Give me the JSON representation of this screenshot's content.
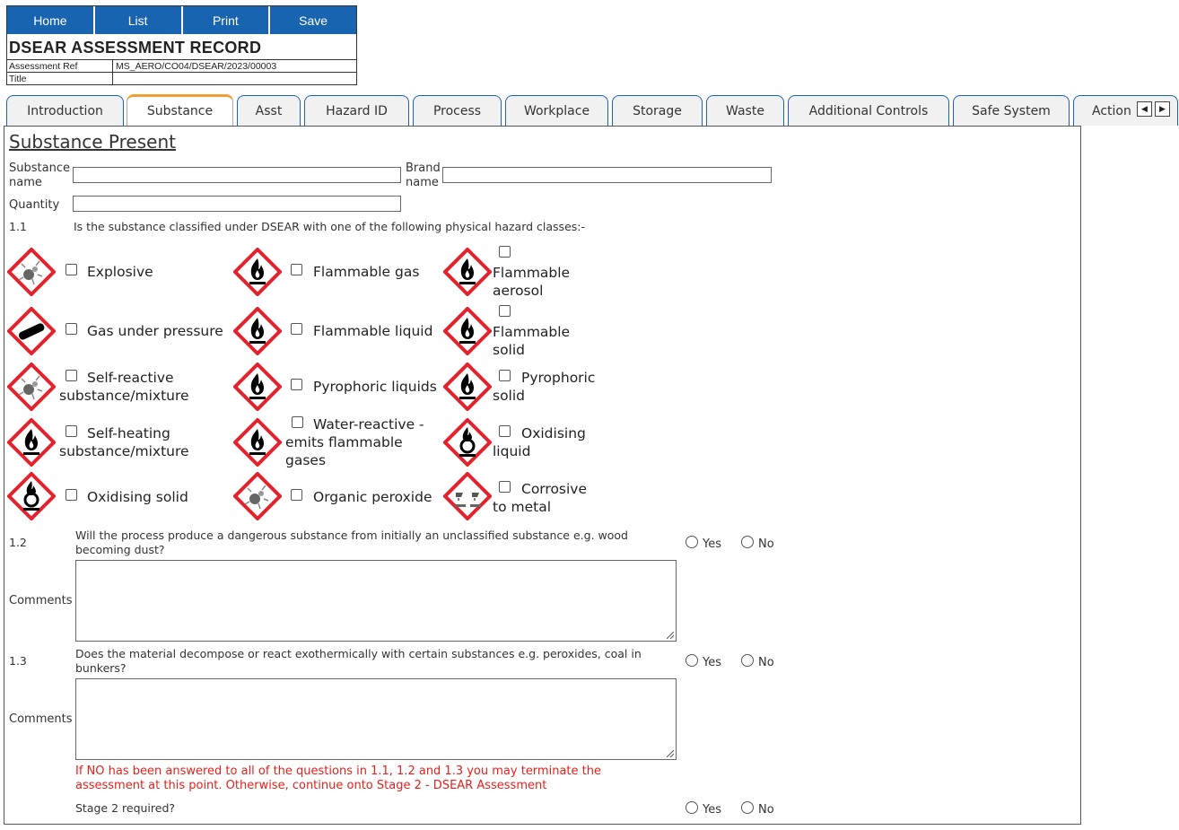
{
  "nav": {
    "home": "Home",
    "list": "List",
    "print": "Print",
    "save": "Save"
  },
  "record": {
    "title": "DSEAR ASSESSMENT RECORD",
    "ref_label": "Assessment Ref",
    "ref_value": "MS_AERO/CO04/DSEAR/2023/00003",
    "title_label": "Title",
    "title_value": ""
  },
  "tabs": [
    {
      "label": "Introduction"
    },
    {
      "label": "Substance"
    },
    {
      "label": "Asst"
    },
    {
      "label": "Hazard ID"
    },
    {
      "label": "Process"
    },
    {
      "label": "Workplace"
    },
    {
      "label": "Storage"
    },
    {
      "label": "Waste"
    },
    {
      "label": "Additional Controls"
    },
    {
      "label": "Safe System"
    },
    {
      "label": "Action"
    }
  ],
  "active_tab": "Substance",
  "section": {
    "heading": "Substance Present",
    "substance_label_1": "Substance",
    "substance_label_2": "name",
    "substance_value": "",
    "brand_label_1": "Brand",
    "brand_label_2": "name",
    "brand_value": "",
    "quantity_label": "Quantity",
    "quantity_value": ""
  },
  "q1_1": {
    "num": "1.1",
    "text": "Is the substance classified under DSEAR with one of the following physical hazard classes:-"
  },
  "hazards": {
    "explosive": "Explosive",
    "flam_gas": "Flammable gas",
    "flam_aerosol_1": "Flammable",
    "flam_aerosol_2": "aerosol",
    "gas_pressure": "Gas under pressure",
    "flam_liquid": "Flammable liquid",
    "flam_solid_1": "Flammable",
    "flam_solid_2": "solid",
    "self_reactive_1": "Self-reactive",
    "self_reactive_2": "substance/mixture",
    "pyro_liquids": "Pyrophoric liquids",
    "pyro_solid_1": "Pyrophoric",
    "pyro_solid_2": "solid",
    "self_heating_1": "Self-heating",
    "self_heating_2": "substance/mixture",
    "water_reactive_1": "Water-reactive -",
    "water_reactive_2": "emits flammable",
    "water_reactive_3": "gases",
    "oxid_liquid_1": "Oxidising",
    "oxid_liquid_2": "liquid",
    "oxid_solid": "Oxidising solid",
    "org_peroxide": "Organic peroxide",
    "corrosive_1": "Corrosive",
    "corrosive_2": "to metal"
  },
  "pictograms": {
    "explosive": "explosive-icon",
    "flame": "flame-icon",
    "gas-cylinder": "gas-cylinder-icon",
    "flame-over-circle": "flame-over-circle-icon",
    "corrosion": "corrosion-icon"
  },
  "q1_2": {
    "num": "1.2",
    "line1": "Will the process produce a dangerous substance from initially an unclassified substance e.g. wood",
    "line2": "becoming dust?",
    "yes": "Yes",
    "no": "No",
    "comments_label": "Comments",
    "comments_value": ""
  },
  "q1_3": {
    "num": "1.3",
    "line1": "Does the material decompose or react exothermically with certain substances e.g. peroxides, coal in",
    "line2": "bunkers?",
    "yes": "Yes",
    "no": "No",
    "comments_label": "Comments",
    "comments_value": ""
  },
  "warning": {
    "line1": "If NO has been answered to all of the questions in 1.1, 1.2 and 1.3 you may terminate the",
    "line2": "assessment at this point. Otherwise, continue onto Stage 2 - DSEAR Assessment"
  },
  "stage2": {
    "label": "Stage 2 required?",
    "yes": "Yes",
    "no": "No"
  },
  "colors": {
    "nav_blue": "#1864b0",
    "tab_accent": "#f0a030",
    "ghs_red": "#e3222d",
    "warning_red": "#e8201c"
  }
}
